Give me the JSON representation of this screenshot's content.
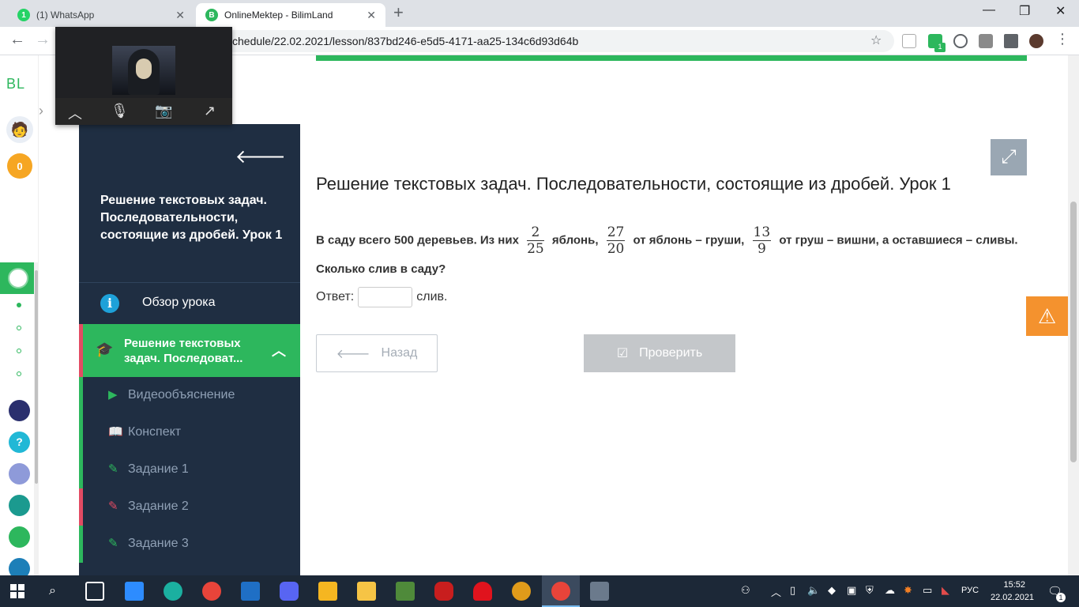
{
  "browser": {
    "tabs": [
      {
        "title": "(1) WhatsApp",
        "icon": "whatsapp-icon",
        "badge": "1",
        "color": "#25d366"
      },
      {
        "title": "OnlineMektep - BilimLand",
        "icon": "bilimland-icon",
        "badge": "B",
        "color": "#2db75d"
      }
    ],
    "url": "chedule/22.02.2021/lesson/837bd246-e5d5-4171-aa25-134c6d93d64b",
    "extension_badge": "1"
  },
  "rail": {
    "logo": "BL",
    "coins": "0"
  },
  "sidebar": {
    "lesson_title": "Решение текстовых задач. Последовательности, состоящие из дробей. Урок 1",
    "overview_label": "Обзор урока",
    "active_section": "Решение текстовых задач. Последоват...",
    "items": [
      {
        "label": "Видеообъяснение",
        "icon": "play-icon",
        "accent": "#2db75d"
      },
      {
        "label": "Конспект",
        "icon": "book-icon",
        "accent": "#2db75d"
      },
      {
        "label": "Задание 1",
        "icon": "edit-icon",
        "accent": "#2db75d"
      },
      {
        "label": "Задание 2",
        "icon": "edit-icon",
        "accent": "#e24b63"
      },
      {
        "label": "Задание 3",
        "icon": "edit-icon",
        "accent": "#2db75d"
      }
    ]
  },
  "main": {
    "title": "Решение текстовых задач. Последовательности, состоящие из дробей. Урок 1",
    "task": {
      "t1": "В саду всего 500 деревьев. Из них",
      "f1n": "2",
      "f1d": "25",
      "t2": "яблонь,",
      "f2n": "27",
      "f2d": "20",
      "t3": "от яблонь – груши,",
      "f3n": "13",
      "f3d": "9",
      "t4": "от груш – вишни, а оставшиеся – сливы. Сколько слив в саду?"
    },
    "answer_label": "Ответ:",
    "answer_value": "",
    "answer_unit": "слив.",
    "back_button": "Назад",
    "check_button": "Проверить"
  },
  "taskbar": {
    "language": "РУС",
    "time": "15:52",
    "date": "22.02.2021",
    "notifications": "1"
  },
  "colors": {
    "brand_green": "#2db75d",
    "sidebar_bg": "#1f2e42",
    "alert_red": "#e24b63",
    "warning_orange": "#f4922e"
  }
}
